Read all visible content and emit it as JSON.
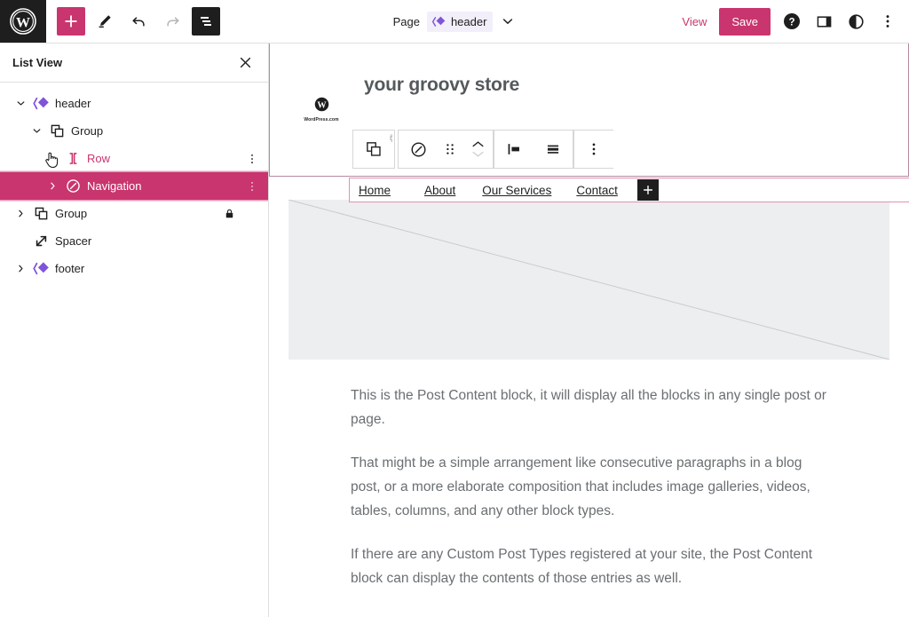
{
  "topbar": {
    "logo_icon": "wordpress-logo-icon",
    "add_block_label": "+",
    "add_block_icon": "plus-icon",
    "tools_icon": "pencil-icon",
    "undo_icon": "undo-arrow-icon",
    "redo_icon": "redo-arrow-icon",
    "list_view_icon": "list-view-icon",
    "document_kind": "Page",
    "document_name": "header",
    "document_icon": "template-part-diamond-icon",
    "document_caret_icon": "chevron-down-icon",
    "view_label": "View",
    "save_label": "Save",
    "help_icon": "help-circle-icon",
    "settings_panel_icon": "sidebar-panel-icon",
    "styles_icon": "contrast-half-circle-icon",
    "more_options_icon": "three-dots-vertical-icon"
  },
  "sidebar": {
    "title": "List View",
    "close_icon": "close-x-icon",
    "items": [
      {
        "label": "header",
        "icon": "template-part-diamond-icon",
        "depth": 0,
        "twisty": "chevron-down-icon",
        "state": "normal",
        "menu": false,
        "lock": false
      },
      {
        "label": "Group",
        "icon": "group-squares-icon",
        "depth": 1,
        "twisty": "chevron-down-icon",
        "state": "normal",
        "menu": false,
        "lock": false
      },
      {
        "label": "Row",
        "icon": "row-brackets-icon",
        "depth": 2,
        "twisty": "",
        "state": "hovered",
        "menu": true,
        "lock": false
      },
      {
        "label": "Navigation",
        "icon": "navigation-compass-icon",
        "depth": 3,
        "twisty": "chevron-right-icon",
        "state": "selected",
        "menu": true,
        "lock": false
      },
      {
        "label": "Group",
        "icon": "group-squares-icon",
        "depth": 0,
        "twisty": "chevron-right-icon",
        "state": "normal",
        "menu": false,
        "lock": true
      },
      {
        "label": "Spacer",
        "icon": "spacer-diagonal-arrow-icon",
        "depth": 0,
        "twisty": "",
        "state": "normal",
        "menu": false,
        "lock": false
      },
      {
        "label": "footer",
        "icon": "template-part-diamond-icon",
        "depth": 0,
        "twisty": "chevron-right-icon",
        "state": "normal",
        "menu": false,
        "lock": false
      }
    ]
  },
  "canvas": {
    "site_title": "your groovy store",
    "logo_icon": "wordpress-circle-icon",
    "logo_caption": "WordPress.com",
    "block_toolbar": {
      "parent_block_icon": "group-squares-icon",
      "block_type_icon": "navigation-compass-icon",
      "drag_handle_icon": "drag-dots-icon",
      "move_up_icon": "chevron-up-icon",
      "move_down_icon": "chevron-down-icon",
      "justify_icon": "justify-items-left-icon",
      "orientation_icon": "horizontal-lines-icon",
      "more_options_icon": "three-dots-vertical-icon"
    },
    "navigation": {
      "items": [
        "Home",
        "About",
        "Our Services",
        "Contact"
      ],
      "appender_label": "+",
      "appender_icon": "plus-icon"
    },
    "image_placeholder_icon": "image-placeholder-diagonal",
    "paragraphs": [
      "This is the Post Content block, it will display all the blocks in any single post or page.",
      "That might be a simple arrangement like consecutive paragraphs in a blog post, or a more elaborate composition that includes image galleries, videos, tables, columns, and any other block types.",
      "If there are any Custom Post Types registered at your site, the Post Content block can display the contents of those entries as well."
    ]
  },
  "colors": {
    "accent_pink": "#c9356e",
    "purple": "#7f54d9",
    "selected_row": "#c9356e",
    "nav_border": "#e291b2",
    "template_border": "#b78ba0",
    "placeholder_bg": "#eceeef"
  }
}
